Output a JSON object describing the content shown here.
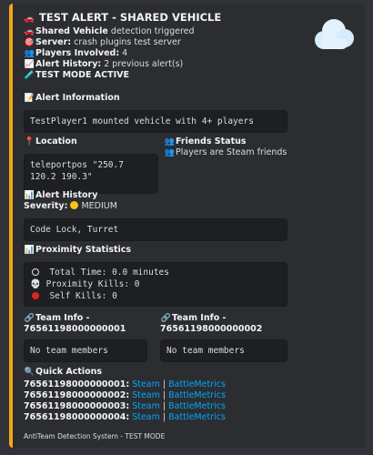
{
  "embed": {
    "accent_color": "#f0a81a",
    "title": "TEST ALERT - SHARED VEHICLE",
    "title_icon": "car-icon",
    "lines": [
      {
        "icon": "car-icon",
        "label": "Shared Vehicle",
        "value": " detection triggered"
      },
      {
        "icon": "target-icon",
        "label": "Server:",
        "value": " crash plugins test server"
      },
      {
        "icon": "players-icon",
        "label": "Players Involved:",
        "value": " 4"
      },
      {
        "icon": "chart-up-icon",
        "label": "Alert History:",
        "value": " 2 previous alert(s)"
      },
      {
        "icon": "test-tube-icon",
        "label": "TEST MODE ACTIVE",
        "value": ""
      }
    ],
    "alert_info": {
      "name": "Alert Information",
      "icon": "memo-icon",
      "value": "TestPlayer1 mounted vehicle with 4+ players"
    },
    "location": {
      "name": "Location",
      "icon": "pin-icon",
      "value": "teleportpos \"250.7\n120.2 190.3\""
    },
    "friends": {
      "name": "Friends Status",
      "icon": "players-icon",
      "value": "Players are Steam friends"
    },
    "history": {
      "name": "Alert History",
      "icon": "bar-chart-icon",
      "severity_label": "Severity:",
      "severity_value": "MEDIUM",
      "value": "Code Lock, Turret"
    },
    "proximity": {
      "name": "Proximity Statistics",
      "icon": "bar-chart-icon",
      "rows": [
        "Total Time: 0.0 minutes",
        "Proximity Kills: 0",
        "Self Kills: 0"
      ]
    },
    "team1": {
      "name_line1": "Team Info -",
      "name_line2": "76561198000000001",
      "value": "No team members"
    },
    "team2": {
      "name_line1": "Team Info -",
      "name_line2": "76561198000000002",
      "value": "No team members"
    },
    "quick_actions": {
      "name": "Quick Actions",
      "icon": "magnifier-icon",
      "rows": [
        {
          "id": "76561198000000001:",
          "steam": "Steam",
          "sep": " | ",
          "bm": "BattleMetrics"
        },
        {
          "id": "76561198000000002:",
          "steam": "Steam",
          "sep": " | ",
          "bm": "BattleMetrics"
        },
        {
          "id": "76561198000000003:",
          "steam": "Steam",
          "sep": " | ",
          "bm": "BattleMetrics"
        },
        {
          "id": "76561198000000004:",
          "steam": "Steam",
          "sep": " | ",
          "bm": "BattleMetrics"
        }
      ]
    },
    "footer": "AntiTeam Detection System - TEST MODE"
  }
}
